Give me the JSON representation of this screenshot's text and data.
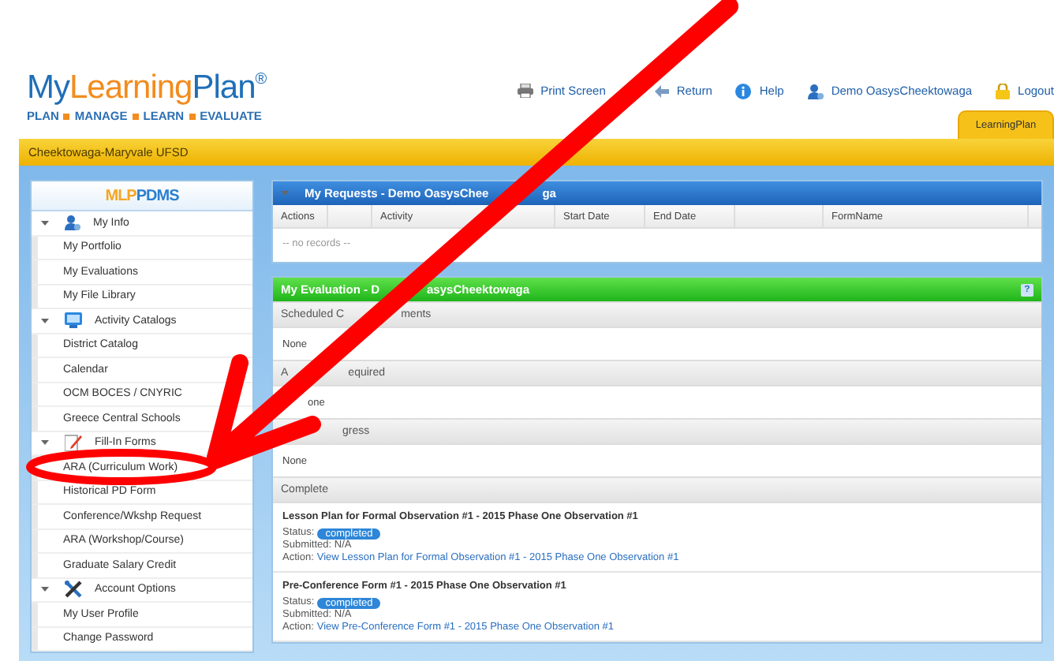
{
  "logo": {
    "parts": [
      {
        "text": "My",
        "color": "#1f6fb8"
      },
      {
        "text": "Learning",
        "color": "#f28c1e"
      },
      {
        "text": "Plan",
        "color": "#1f6fb8"
      },
      {
        "text": "®",
        "color": "#1f6fb8"
      }
    ],
    "tagline": [
      "PLAN",
      "MANAGE",
      "LEARN",
      "EVALUATE"
    ]
  },
  "top_links": [
    {
      "kind": "printer",
      "label": "Print Screen"
    },
    {
      "kind": "return",
      "label": "Return"
    },
    {
      "kind": "help",
      "label": "Help"
    },
    {
      "kind": "user",
      "label": "Demo OasysCheektowaga"
    },
    {
      "kind": "lock",
      "label": "Logout"
    }
  ],
  "tabs": [
    {
      "label": "LearningPlan",
      "selected": true
    }
  ],
  "district": "Cheektowaga-Maryvale UFSD",
  "sidebar": {
    "brand": [
      {
        "text": "MLP",
        "color": "#f5a623"
      },
      {
        "text": "PDMS",
        "color": "#2b7fd0"
      }
    ],
    "groups": [
      {
        "kind": "user",
        "label": "My Info",
        "expanded": true,
        "items": [
          "My Portfolio",
          "My Evaluations",
          "My File Library"
        ]
      },
      {
        "kind": "monitor",
        "label": "Activity Catalogs",
        "expanded": true,
        "items": [
          "District Catalog",
          "Calendar",
          "OCM BOCES / CNYRIC",
          "Greece Central Schools"
        ]
      },
      {
        "kind": "form",
        "label": "Fill-In Forms",
        "expanded": true,
        "items": [
          "ARA (Curriculum Work)",
          "Historical PD Form",
          "Conference/Wkshp Request",
          "ARA (Workshop/Course)",
          "Graduate Salary Credit"
        ]
      },
      {
        "kind": "tools",
        "label": "Account Options",
        "expanded": true,
        "items": [
          "My User Profile",
          "Change Password"
        ]
      }
    ]
  },
  "requests": {
    "title": "My Requests - Demo OasysChee",
    "title_tail": "ga",
    "columns": [
      {
        "kind": "text",
        "label": "Actions"
      },
      {
        "kind": "blank"
      },
      {
        "kind": "text",
        "label": "Activity"
      },
      {
        "kind": "text",
        "label": "Start Date"
      },
      {
        "kind": "text",
        "label": "End Date"
      },
      {
        "kind": "blank"
      },
      {
        "kind": "text",
        "label": "FormName"
      }
    ],
    "empty": "-- no records --"
  },
  "evaluation": {
    "title": "My Evaluation - D",
    "title_tail": "asysCheektowaga",
    "help": "?",
    "sections": [
      {
        "header": "Scheduled C",
        "header_tail": "ments",
        "body": "None"
      },
      {
        "header": "A",
        "header_tail": "equired",
        "body": "one"
      },
      {
        "header_tail": "gress",
        "body": "None"
      },
      {
        "header": "Complete",
        "entries": [
          {
            "title": "Lesson Plan for Formal Observation #1 - 2015 Phase One Observation #1",
            "status_label": "Status:",
            "status": "completed",
            "submitted": "Submitted: N/A",
            "action_label": "Action:",
            "action": "View Lesson Plan for Formal Observation #1 - 2015 Phase One Observation #1"
          },
          {
            "title": "Pre-Conference Form #1 - 2015 Phase One Observation #1",
            "status_label": "Status:",
            "status": "completed",
            "submitted": "Submitted: N/A",
            "action_label": "Action:",
            "action": "View Pre-Conference Form #1 - 2015 Phase One Observation #1"
          }
        ]
      }
    ]
  }
}
